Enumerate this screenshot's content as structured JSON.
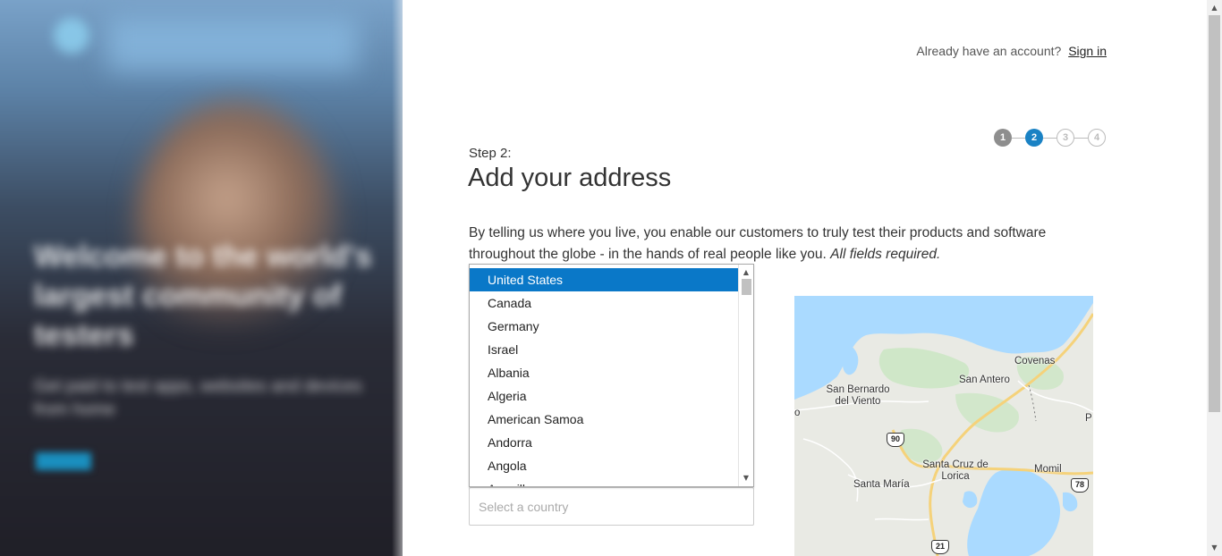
{
  "header": {
    "account_prompt": "Already have an account?",
    "signin_label": "Sign in"
  },
  "stepper": {
    "steps": [
      "1",
      "2",
      "3",
      "4"
    ],
    "current": 2
  },
  "form": {
    "step_label": "Step 2:",
    "heading": "Add your address",
    "intro_text": "By telling us where you live, you enable our customers to truly test their products and software throughout the globe - in the hands of real people like you.",
    "intro_required": "All fields required.",
    "country_placeholder": "Select a country"
  },
  "country_dropdown": {
    "selected": "United States",
    "options": [
      "United States",
      "Canada",
      "Germany",
      "Israel",
      "Albania",
      "Algeria",
      "American Samoa",
      "Andorra",
      "Angola",
      "Anguilla"
    ]
  },
  "map": {
    "labels": [
      "Covenas",
      "San Antero",
      "San Bernardo del Viento",
      "Santa Cruz de Lorica",
      "Momil",
      "Santa María",
      "o",
      "P"
    ],
    "route_shields": [
      "90",
      "78",
      "21"
    ]
  },
  "colors": {
    "accent": "#0a78c8",
    "step_done": "#8e8e8e",
    "step_active": "#1a82c4",
    "error_border": "#d9534f",
    "water": "#aadaff"
  },
  "hero": {
    "title": "Welcome to the world's largest community of testers",
    "subtitle": "Get paid to test apps, websites and devices from home",
    "cta": "Learn more"
  }
}
